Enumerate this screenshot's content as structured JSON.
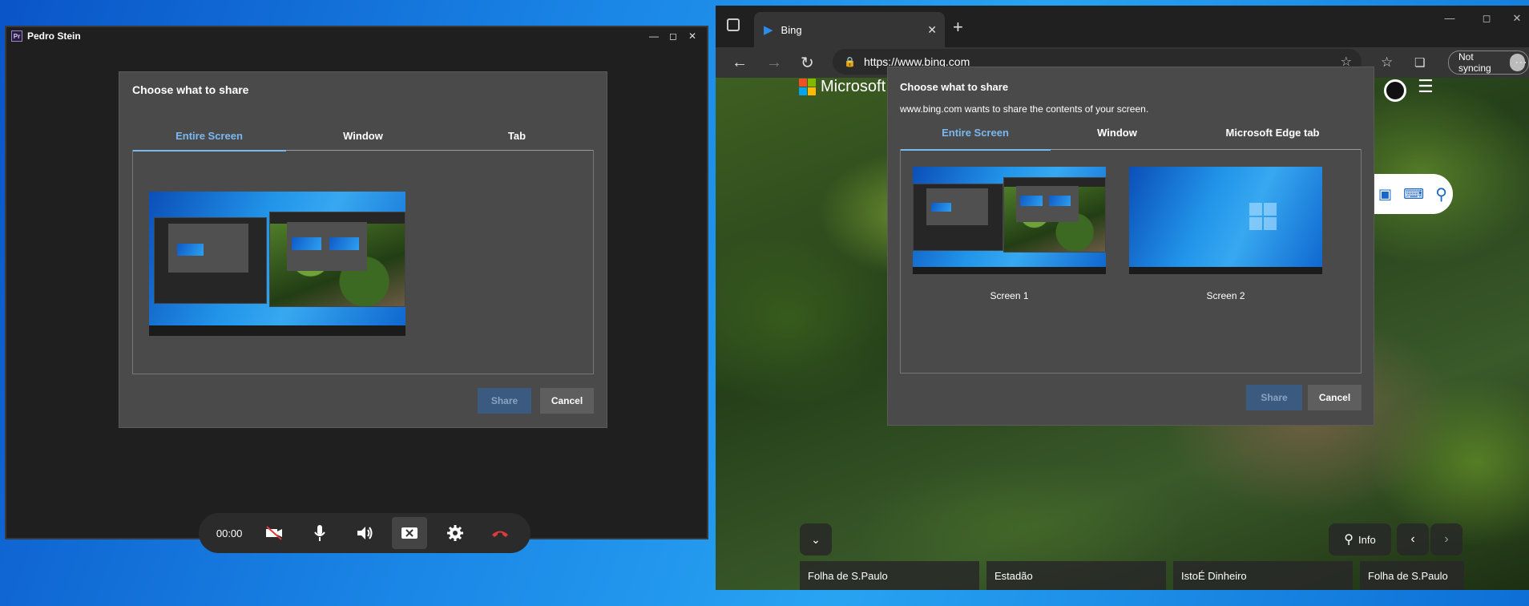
{
  "app": {
    "title": "Pedro Stein",
    "logo_text": "Pr",
    "dialog": {
      "title": "Choose what to share",
      "tabs": [
        "Entire Screen",
        "Window",
        "Tab"
      ],
      "share_label": "Share",
      "cancel_label": "Cancel"
    },
    "callbar": {
      "timer": "00:00"
    }
  },
  "browser": {
    "tab_title": "Bing",
    "url": "https://www.bing.com",
    "sync_label": "Not syncing",
    "brand_partial": "Microsoft",
    "dialog": {
      "title": "Choose what to share",
      "subtitle": "www.bing.com wants to share the contents of your screen.",
      "tabs": [
        "Entire Screen",
        "Window",
        "Microsoft Edge tab"
      ],
      "screens": [
        "Screen 1",
        "Screen 2"
      ],
      "share_label": "Share",
      "cancel_label": "Cancel"
    },
    "info_label": "Info",
    "news": [
      "Folha de S.Paulo",
      "Estadão",
      "IstoÉ Dinheiro",
      "Folha de S.Paulo"
    ]
  },
  "colors": {
    "accent": "#7ab8f0",
    "hangup": "#e03a3a",
    "dialog_bg": "#4a4a4a"
  }
}
